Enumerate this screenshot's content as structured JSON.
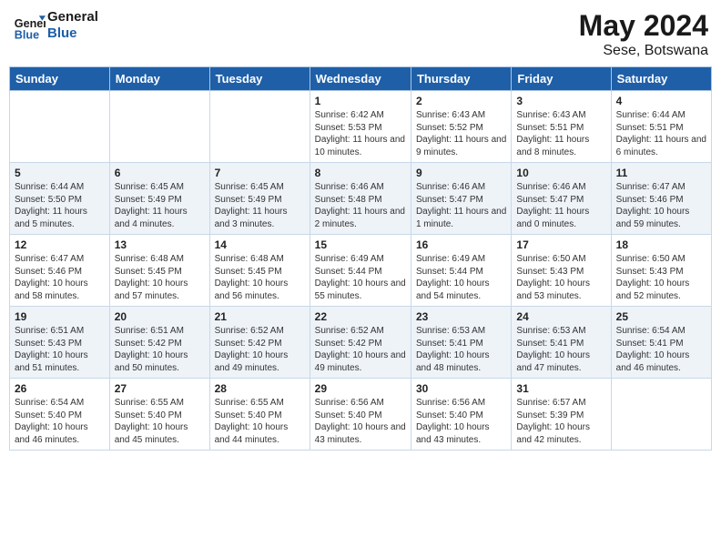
{
  "header": {
    "logo_line1": "General",
    "logo_line2": "Blue",
    "title": "May 2024",
    "subtitle": "Sese, Botswana"
  },
  "days_of_week": [
    "Sunday",
    "Monday",
    "Tuesday",
    "Wednesday",
    "Thursday",
    "Friday",
    "Saturday"
  ],
  "weeks": [
    [
      {
        "num": "",
        "info": ""
      },
      {
        "num": "",
        "info": ""
      },
      {
        "num": "",
        "info": ""
      },
      {
        "num": "1",
        "info": "Sunrise: 6:42 AM\nSunset: 5:53 PM\nDaylight: 11 hours and 10 minutes."
      },
      {
        "num": "2",
        "info": "Sunrise: 6:43 AM\nSunset: 5:52 PM\nDaylight: 11 hours and 9 minutes."
      },
      {
        "num": "3",
        "info": "Sunrise: 6:43 AM\nSunset: 5:51 PM\nDaylight: 11 hours and 8 minutes."
      },
      {
        "num": "4",
        "info": "Sunrise: 6:44 AM\nSunset: 5:51 PM\nDaylight: 11 hours and 6 minutes."
      }
    ],
    [
      {
        "num": "5",
        "info": "Sunrise: 6:44 AM\nSunset: 5:50 PM\nDaylight: 11 hours and 5 minutes."
      },
      {
        "num": "6",
        "info": "Sunrise: 6:45 AM\nSunset: 5:49 PM\nDaylight: 11 hours and 4 minutes."
      },
      {
        "num": "7",
        "info": "Sunrise: 6:45 AM\nSunset: 5:49 PM\nDaylight: 11 hours and 3 minutes."
      },
      {
        "num": "8",
        "info": "Sunrise: 6:46 AM\nSunset: 5:48 PM\nDaylight: 11 hours and 2 minutes."
      },
      {
        "num": "9",
        "info": "Sunrise: 6:46 AM\nSunset: 5:47 PM\nDaylight: 11 hours and 1 minute."
      },
      {
        "num": "10",
        "info": "Sunrise: 6:46 AM\nSunset: 5:47 PM\nDaylight: 11 hours and 0 minutes."
      },
      {
        "num": "11",
        "info": "Sunrise: 6:47 AM\nSunset: 5:46 PM\nDaylight: 10 hours and 59 minutes."
      }
    ],
    [
      {
        "num": "12",
        "info": "Sunrise: 6:47 AM\nSunset: 5:46 PM\nDaylight: 10 hours and 58 minutes."
      },
      {
        "num": "13",
        "info": "Sunrise: 6:48 AM\nSunset: 5:45 PM\nDaylight: 10 hours and 57 minutes."
      },
      {
        "num": "14",
        "info": "Sunrise: 6:48 AM\nSunset: 5:45 PM\nDaylight: 10 hours and 56 minutes."
      },
      {
        "num": "15",
        "info": "Sunrise: 6:49 AM\nSunset: 5:44 PM\nDaylight: 10 hours and 55 minutes."
      },
      {
        "num": "16",
        "info": "Sunrise: 6:49 AM\nSunset: 5:44 PM\nDaylight: 10 hours and 54 minutes."
      },
      {
        "num": "17",
        "info": "Sunrise: 6:50 AM\nSunset: 5:43 PM\nDaylight: 10 hours and 53 minutes."
      },
      {
        "num": "18",
        "info": "Sunrise: 6:50 AM\nSunset: 5:43 PM\nDaylight: 10 hours and 52 minutes."
      }
    ],
    [
      {
        "num": "19",
        "info": "Sunrise: 6:51 AM\nSunset: 5:43 PM\nDaylight: 10 hours and 51 minutes."
      },
      {
        "num": "20",
        "info": "Sunrise: 6:51 AM\nSunset: 5:42 PM\nDaylight: 10 hours and 50 minutes."
      },
      {
        "num": "21",
        "info": "Sunrise: 6:52 AM\nSunset: 5:42 PM\nDaylight: 10 hours and 49 minutes."
      },
      {
        "num": "22",
        "info": "Sunrise: 6:52 AM\nSunset: 5:42 PM\nDaylight: 10 hours and 49 minutes."
      },
      {
        "num": "23",
        "info": "Sunrise: 6:53 AM\nSunset: 5:41 PM\nDaylight: 10 hours and 48 minutes."
      },
      {
        "num": "24",
        "info": "Sunrise: 6:53 AM\nSunset: 5:41 PM\nDaylight: 10 hours and 47 minutes."
      },
      {
        "num": "25",
        "info": "Sunrise: 6:54 AM\nSunset: 5:41 PM\nDaylight: 10 hours and 46 minutes."
      }
    ],
    [
      {
        "num": "26",
        "info": "Sunrise: 6:54 AM\nSunset: 5:40 PM\nDaylight: 10 hours and 46 minutes."
      },
      {
        "num": "27",
        "info": "Sunrise: 6:55 AM\nSunset: 5:40 PM\nDaylight: 10 hours and 45 minutes."
      },
      {
        "num": "28",
        "info": "Sunrise: 6:55 AM\nSunset: 5:40 PM\nDaylight: 10 hours and 44 minutes."
      },
      {
        "num": "29",
        "info": "Sunrise: 6:56 AM\nSunset: 5:40 PM\nDaylight: 10 hours and 43 minutes."
      },
      {
        "num": "30",
        "info": "Sunrise: 6:56 AM\nSunset: 5:40 PM\nDaylight: 10 hours and 43 minutes."
      },
      {
        "num": "31",
        "info": "Sunrise: 6:57 AM\nSunset: 5:39 PM\nDaylight: 10 hours and 42 minutes."
      },
      {
        "num": "",
        "info": ""
      }
    ]
  ]
}
